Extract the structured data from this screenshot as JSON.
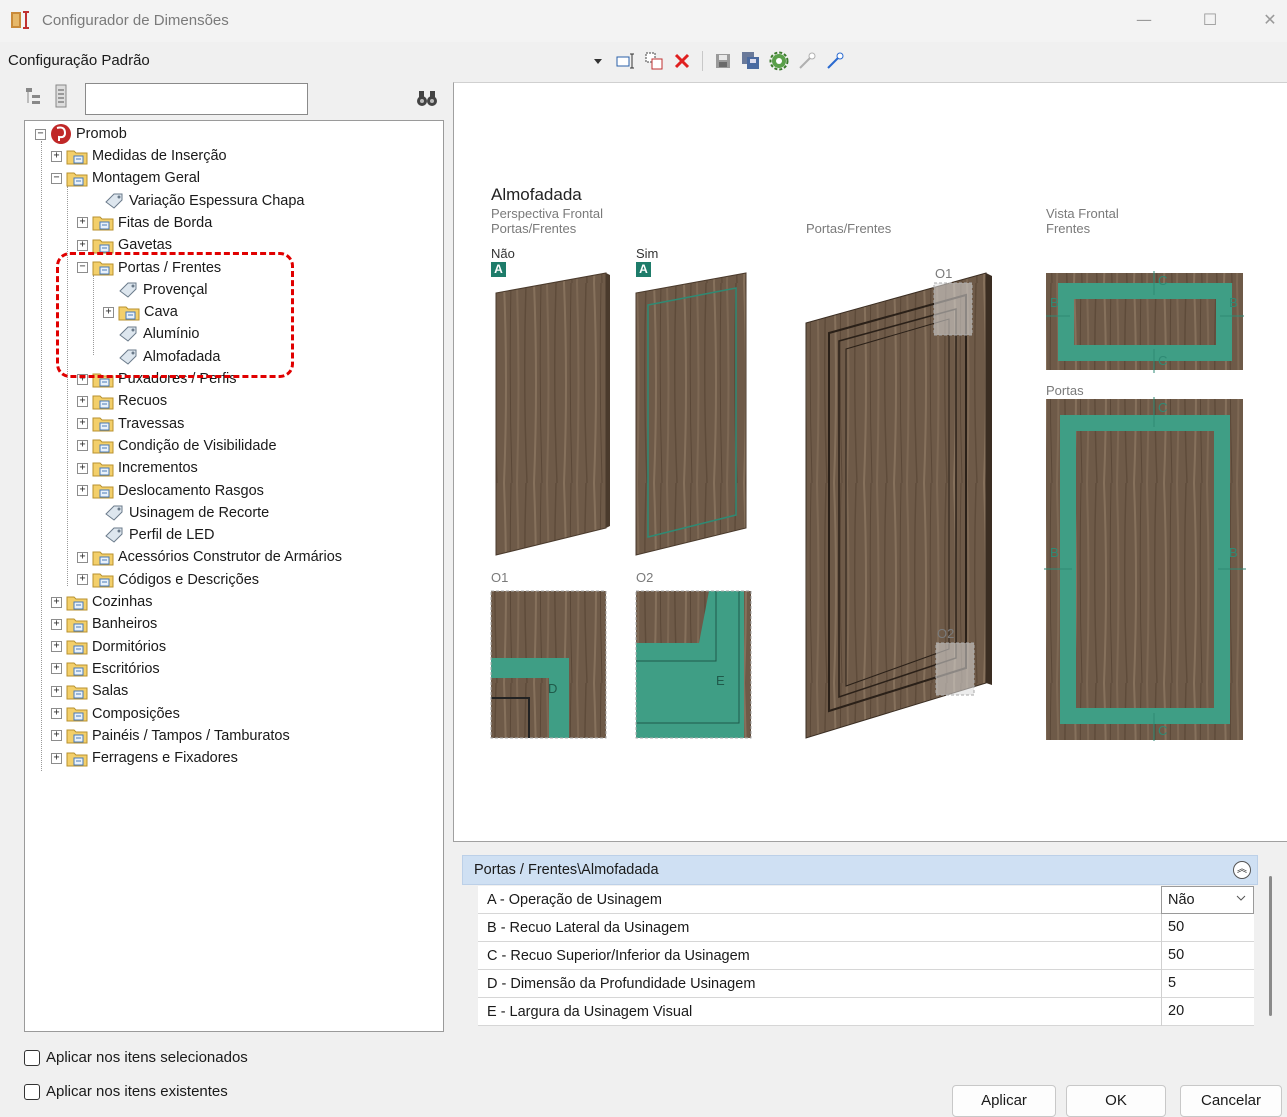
{
  "window": {
    "title": "Configurador de Dimensões",
    "minimize": "—",
    "maximize": "☐",
    "close": "✕"
  },
  "config_label": "Configuração Padrão",
  "search": {
    "value": "",
    "placeholder": ""
  },
  "tree": {
    "root": "Promob",
    "items": [
      "Medidas de Inserção",
      "Montagem Geral",
      "Variação Espessura Chapa",
      "Fitas de Borda",
      "Gavetas",
      "Portas / Frentes",
      "Provençal",
      "Cava",
      "Alumínio",
      "Almofadada",
      "Puxadores / Perfis",
      "Recuos",
      "Travessas",
      "Condição de Visibilidade",
      "Incrementos",
      "Deslocamento Rasgos",
      "Usinagem de Recorte",
      "Perfil de LED",
      "Acessórios Construtor de Armários",
      "Códigos e Descrições",
      "Cozinhas",
      "Banheiros",
      "Dormitórios",
      "Escritórios",
      "Salas",
      "Composições",
      "Painéis / Tampos / Tamburatos",
      "Ferragens e Fixadores"
    ]
  },
  "options": {
    "apply_selected": "Aplicar nos itens selecionados",
    "apply_existing": "Aplicar nos itens existentes"
  },
  "preview": {
    "title": "Almofadada",
    "persp_1": "Perspectiva Frontal",
    "persp_2": "Portas/Frentes",
    "center_label": "Portas/Frentes",
    "vista_1": "Vista Frontal",
    "vista_2": "Frentes",
    "nao": "Não",
    "sim": "Sim",
    "badge": "A",
    "o1": "O1",
    "o2": "O2",
    "portas": "Portas",
    "letter_b": "B",
    "letter_c": "C",
    "letter_d": "D",
    "letter_e": "E"
  },
  "properties": {
    "header": "Portas / Frentes\\Almofadada",
    "rows": [
      {
        "name": "A - Operação de Usinagem",
        "value": "Não"
      },
      {
        "name": "B - Recuo Lateral da Usinagem",
        "value": "50"
      },
      {
        "name": "C - Recuo Superior/Inferior da Usinagem",
        "value": "50"
      },
      {
        "name": "D - Dimensão da Profundidade Usinagem",
        "value": "5"
      },
      {
        "name": "E - Largura da Usinagem Visual",
        "value": "20"
      }
    ]
  },
  "buttons": {
    "apply": "Aplicar",
    "ok": "OK",
    "cancel": "Cancelar"
  },
  "colors": {
    "accent_teal": "#3f9e85",
    "wood": "#6e5a48",
    "header_blue": "#cfe0f3",
    "highlight_red": "#e00000"
  }
}
